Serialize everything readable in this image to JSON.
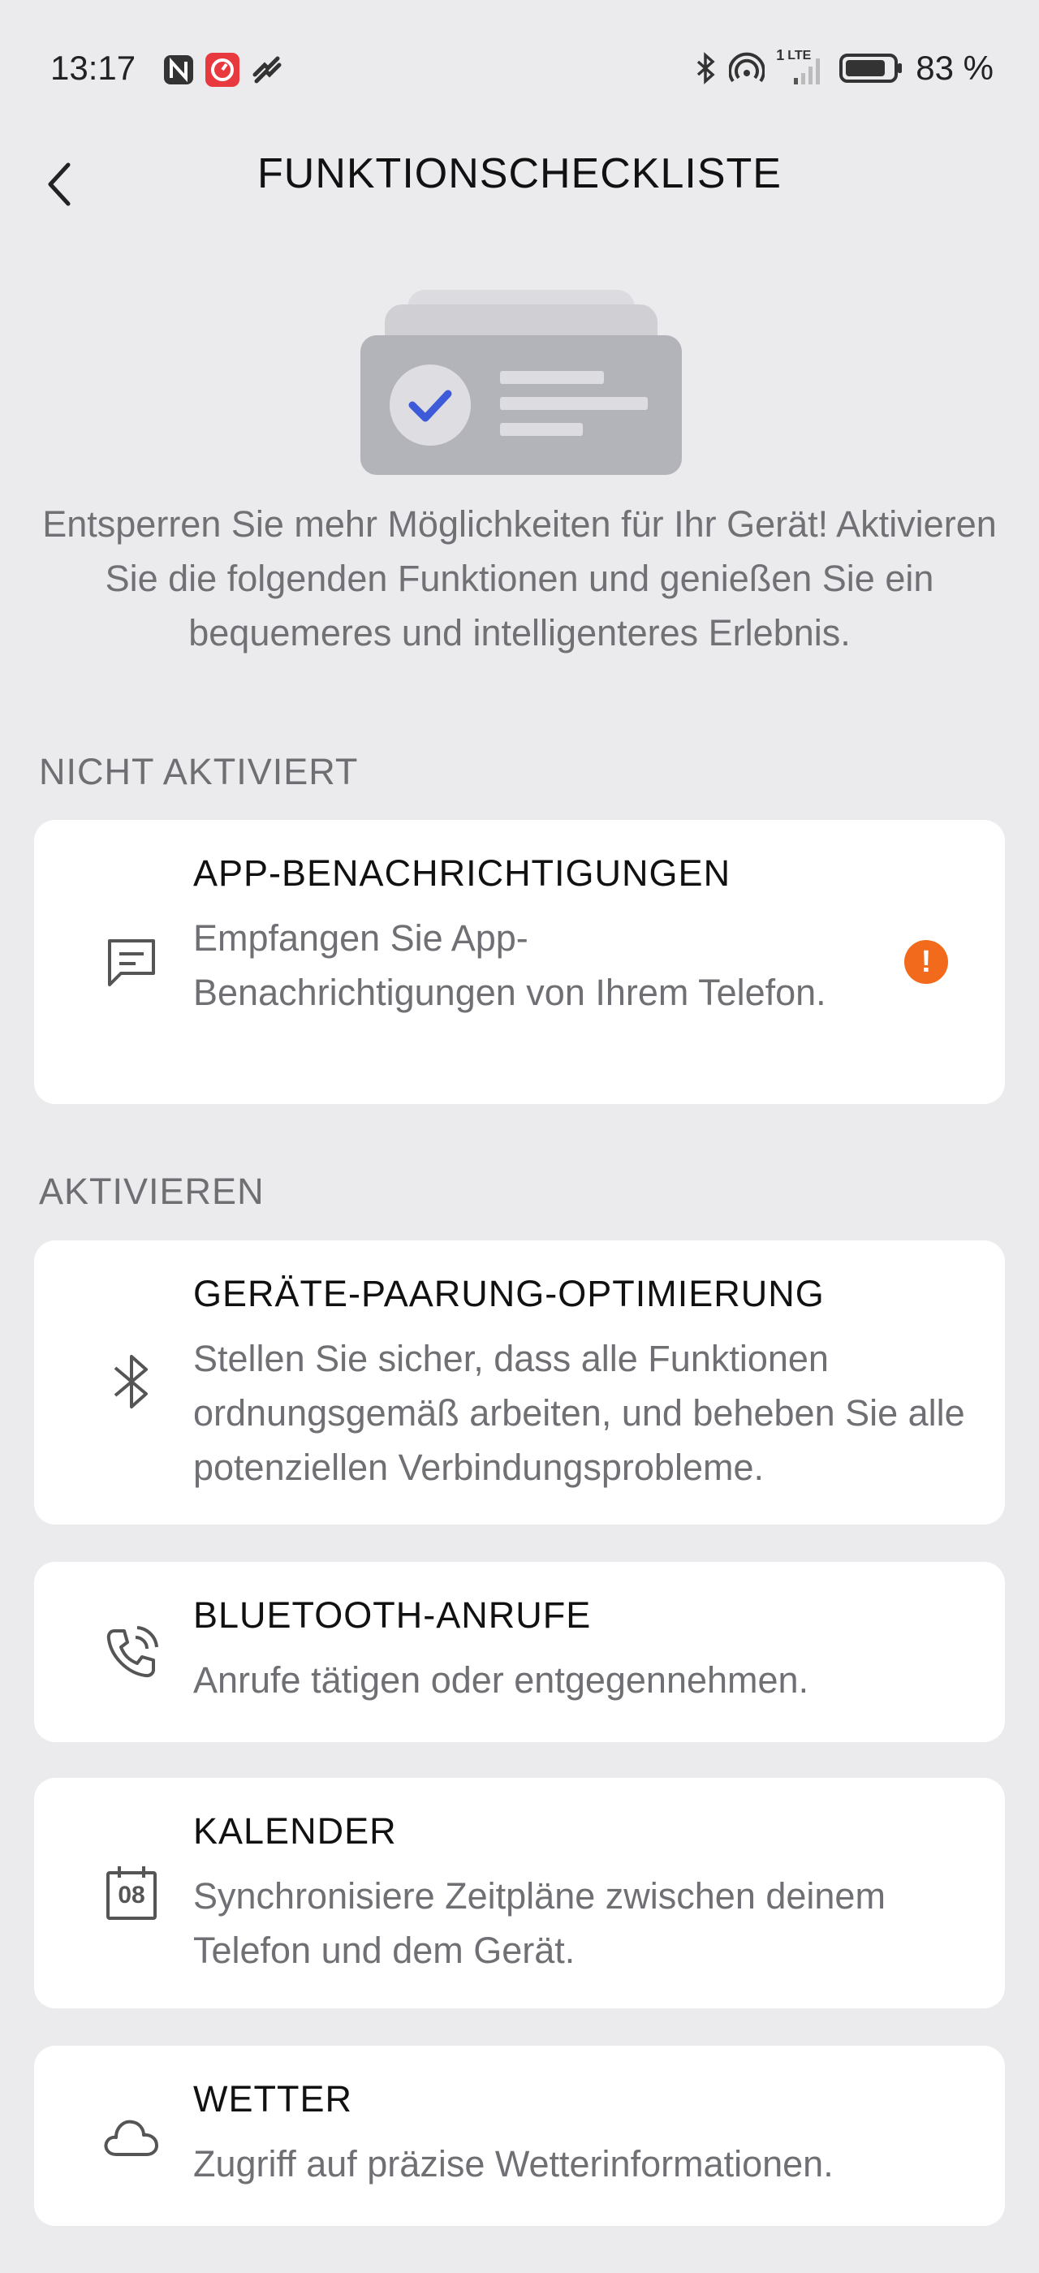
{
  "status_bar": {
    "time": "13:17",
    "battery": "83 %",
    "network": "LTE",
    "sim": "1"
  },
  "header": {
    "title": "FUNKTIONSCHECKLISTE"
  },
  "intro": "Entsperren Sie mehr Möglichkeiten für Ihr Gerät! Aktivieren Sie die folgenden Funktionen und genießen Sie ein bequemeres und intelligenteres Erlebnis.",
  "sections": {
    "not_activated": {
      "label": "NICHT AKTIVIERT",
      "items": [
        {
          "title": "APP-BENACHRICHTIGUNGEN",
          "description": "Empfangen Sie App-Benachrichtigungen von Ihrem Telefon.",
          "icon": "message-icon",
          "warning": "!"
        }
      ]
    },
    "activate": {
      "label": "AKTIVIEREN",
      "items": [
        {
          "title": "GERÄTE-PAARUNG-OPTIMIERUNG",
          "description": "Stellen Sie sicher, dass alle Funktionen ordnungsgemäß arbeiten, und beheben Sie alle potenziellen Verbindungsprobleme.",
          "icon": "bluetooth-icon"
        },
        {
          "title": "BLUETOOTH-ANRUFE",
          "description": "Anrufe tätigen oder entgegennehmen.",
          "icon": "phone-call-icon"
        },
        {
          "title": "KALENDER",
          "description": "Synchronisiere Zeitpläne zwischen deinem Telefon und dem Gerät.",
          "icon": "calendar-icon",
          "icon_text": "08"
        },
        {
          "title": "WETTER",
          "description": "Zugriff auf präzise Wetterinformationen.",
          "icon": "cloud-icon"
        }
      ]
    }
  },
  "colors": {
    "background": "#ebebee",
    "card": "#ffffff",
    "warning": "#f26a1b",
    "check_blue": "#3d5bd9"
  }
}
